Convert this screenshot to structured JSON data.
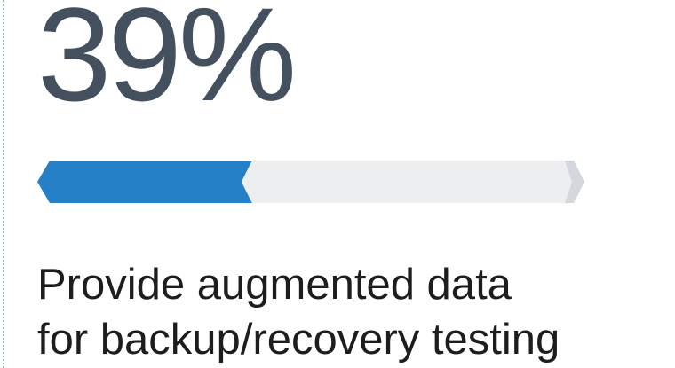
{
  "stat": {
    "value": "39%",
    "progress_fraction": 0.39
  },
  "caption": {
    "line1": "Provide augmented data",
    "line2": "for backup/recovery testing"
  },
  "colors": {
    "accent": "#2680c8",
    "track": "#eceeef",
    "track_end": "#d4d8dd",
    "text_dark": "#44505d",
    "text": "#1d1d1d",
    "rule": "#8fb8b3"
  }
}
